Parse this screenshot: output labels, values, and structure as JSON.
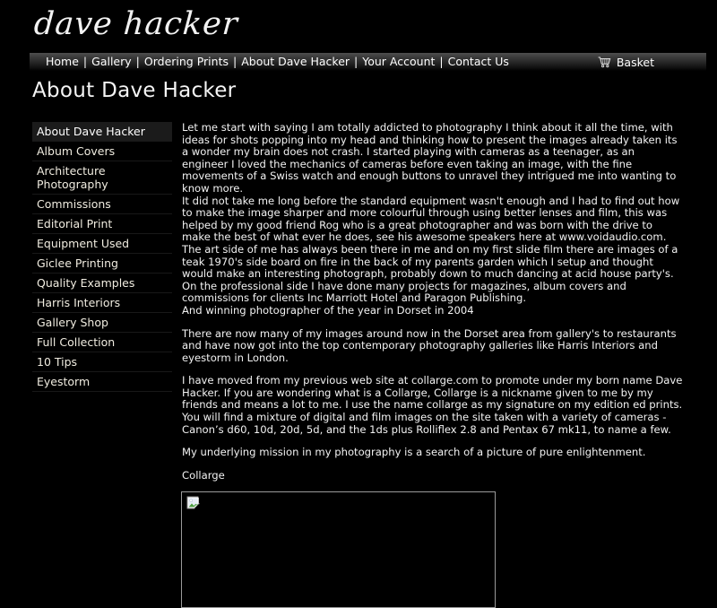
{
  "site": {
    "logo_text": "dave hacker"
  },
  "nav": {
    "links": [
      {
        "label": "Home"
      },
      {
        "label": "Gallery"
      },
      {
        "label": "Ordering Prints"
      },
      {
        "label": "About Dave Hacker"
      },
      {
        "label": "Your Account"
      },
      {
        "label": "Contact Us"
      }
    ],
    "separator": "|",
    "basket_label": "Basket",
    "basket_icon": "shopping-cart-icon"
  },
  "page": {
    "title": "About Dave Hacker"
  },
  "sidebar": {
    "items": [
      {
        "label": "About Dave Hacker",
        "active": true
      },
      {
        "label": "Album Covers",
        "active": false
      },
      {
        "label": "Architecture Photography",
        "active": false
      },
      {
        "label": "Commissions",
        "active": false
      },
      {
        "label": "Editorial Print",
        "active": false
      },
      {
        "label": "Equipment Used",
        "active": false
      },
      {
        "label": "Giclee Printing",
        "active": false
      },
      {
        "label": "Quality Examples",
        "active": false
      },
      {
        "label": "Harris Interiors",
        "active": false
      },
      {
        "label": "Gallery Shop",
        "active": false
      },
      {
        "label": "Full Collection",
        "active": false
      },
      {
        "label": "10 Tips",
        "active": false
      },
      {
        "label": "Eyestorm",
        "active": false
      }
    ]
  },
  "article": {
    "paragraphs": [
      "Let me start with saying I am totally addicted to photography I think about it all the time, with ideas for shots popping into my head and thinking how to present the images already taken its a wonder my brain does not crash.  I started playing with cameras as a teenager, as an engineer I loved the mechanics of cameras before even taking an image, with the fine movements of a Swiss watch and enough buttons to unravel they intrigued me into wanting to know more.",
      "It did not take me long before the standard equipment wasn't enough and I had to find out how to make the image sharper and more colourful through using better lenses and film, this was helped by my good friend Rog who is a great photographer and was born with the drive to make the best of what ever he does, see his awesome speakers here at www.voidaudio.com.",
      "The art side of me has always been there in me and on my first slide film there are images of a teak 1970's side board on fire in the back of my parents garden which I setup and thought would make an interesting photograph, probably down to much dancing at acid house party's.",
      "On the professional side I have done many projects for magazines, album covers and commissions for clients Inc Marriott Hotel and Paragon Publishing.",
      "And winning photographer of the year in Dorset in 2004",
      "There are now many of my images around now in the Dorset area from gallery's to restaurants and have now got into the top contemporary photography galleries like Harris Interiors and eyestorm in London.",
      "I have moved from my previous web site at collarge.com to promote under my born name Dave Hacker. If you are wondering what is a Collarge, Collarge is a nickname given to me by my friends and means a lot to me. I use the name collarge as my signature on my edition ed prints.",
      "You will find a mixture of digital and film images on the site taken with a variety of cameras - Canon’s d60, 10d, 20d, 5d, and the 1ds plus Rolliflex 2.8 and Pentax 67 mk11, to name a few.",
      "My underlying mission in my photography is a search of a picture of pure enlightenment.",
      "Collarge"
    ]
  },
  "footer_image": {
    "alt_icon": "broken-image-icon"
  }
}
